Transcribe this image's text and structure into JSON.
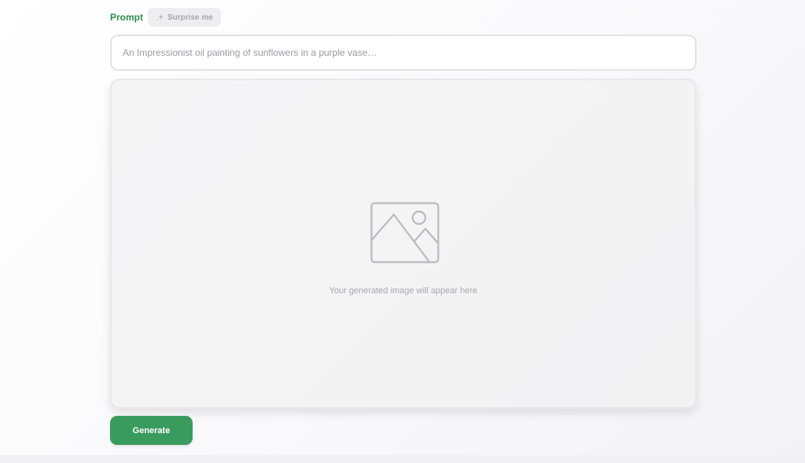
{
  "prompt": {
    "label": "Prompt",
    "surprise_label": "Surprise me",
    "surprise_icon": "sparkle-icon",
    "input_placeholder": "An Impressionist oil painting of sunflowers in a purple vase…",
    "input_value": ""
  },
  "preview": {
    "icon": "image-placeholder-icon",
    "empty_text": "Your generated image will appear here"
  },
  "actions": {
    "generate_label": "Generate"
  },
  "colors": {
    "accent": "#3a9b5e",
    "label_green": "#2f8a4e",
    "muted_text": "#a7a7b0",
    "border": "#e3e3e7"
  }
}
